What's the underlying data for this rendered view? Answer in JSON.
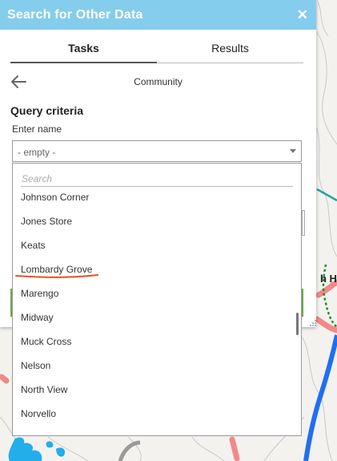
{
  "window": {
    "title": "Search for Other Data",
    "close_symbol": "✕"
  },
  "tabs": [
    "Tasks",
    "Results"
  ],
  "breadcrumb": "Community",
  "query": {
    "heading": "Query criteria",
    "field_label": "Enter name",
    "select_value": "- empty -"
  },
  "dropdown": {
    "search_placeholder": "Search",
    "items": [
      "Johnson Corner",
      "Jones Store",
      "Keats",
      "Lombardy Grove",
      "Marengo",
      "Midway",
      "Muck Cross",
      "Nelson",
      "North View",
      "Norvello"
    ],
    "highlighted_item": "Lombardy Grove"
  },
  "map": {
    "label_partial": "h Hi"
  },
  "colors": {
    "title_bar": "#85cdec",
    "action_button": "#6aa84f",
    "annotation": "#e8511c",
    "road_blue": "#1f6ff2",
    "road_teal": "#1aa79a",
    "road_pink": "#f08a88"
  }
}
